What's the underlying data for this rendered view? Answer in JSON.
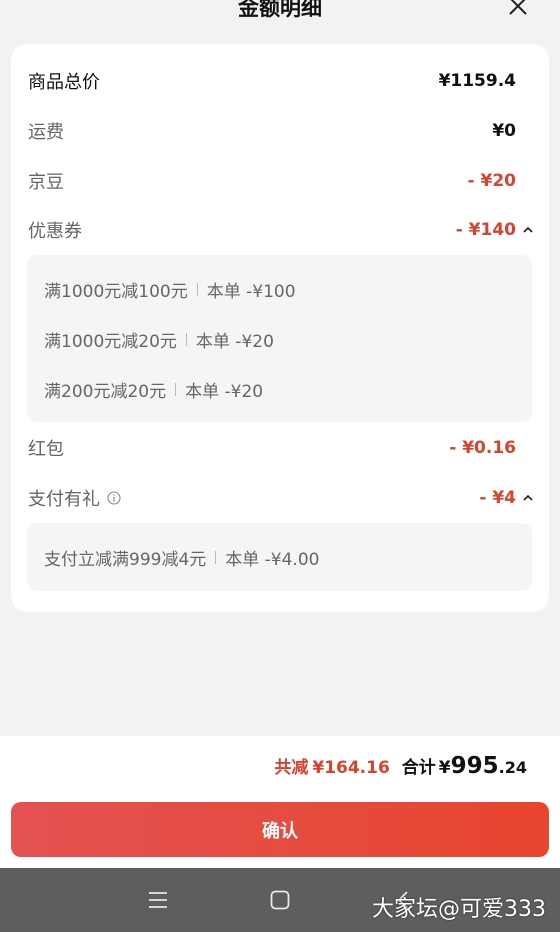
{
  "header": {
    "title": "金额明细"
  },
  "rows": [
    {
      "label": "商品总价",
      "value": "¥1159.4"
    },
    {
      "label": "运费",
      "value": "¥0"
    },
    {
      "label": "京豆",
      "value": "- ¥20"
    },
    {
      "label": "优惠券",
      "value": "- ¥140"
    },
    {
      "label": "红包",
      "value": "- ¥0.16"
    },
    {
      "label": "支付有礼",
      "value": "- ¥4"
    }
  ],
  "coupons": [
    {
      "name": "满1000元减100元",
      "detail": "本单 -¥100"
    },
    {
      "name": "满1000元减20元",
      "detail": "本单 -¥20"
    },
    {
      "name": "满200元减20元",
      "detail": "本单 -¥20"
    }
  ],
  "payment_gifts": [
    {
      "name": "支付立减满999减4元",
      "detail": "本单 -¥4.00"
    }
  ],
  "summary": {
    "discount_label": "共减",
    "discount_value": "¥164.16",
    "total_label": "合计",
    "total_symbol": "¥",
    "total_int": "995",
    "total_dec": ".24"
  },
  "confirm_label": "确认",
  "watermark": "大家坛@可爱333",
  "colors": {
    "accent": "#d6442e",
    "button_start": "#e35252",
    "button_end": "#e8452e"
  },
  "icons": [
    "close-icon",
    "chevron-up-icon",
    "info-icon",
    "nav-menu-icon",
    "nav-home-icon",
    "nav-back-icon"
  ]
}
